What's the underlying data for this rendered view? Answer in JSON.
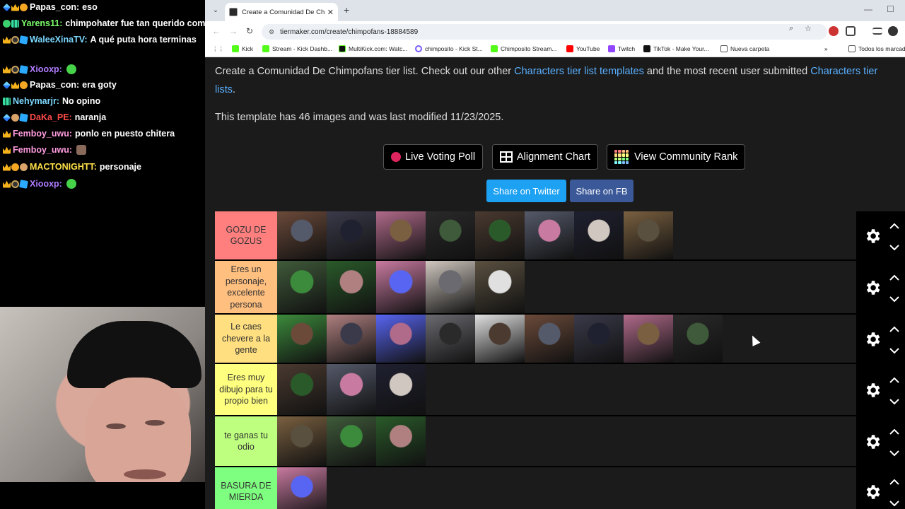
{
  "chat": {
    "messages": [
      {
        "user": "Papas_con:",
        "text": "eso",
        "color": "#ffffff",
        "badges": [
          "sword",
          "crown",
          "warn"
        ],
        "emote": ""
      },
      {
        "user": "Yarens11:",
        "text": "chimpohater fue tan querido como un here",
        "color": "#7cff6a",
        "badges": [
          "green",
          "grid"
        ],
        "emote": "green"
      },
      {
        "user": "WaleeXinaTV:",
        "text": "A qué puta hora terminas",
        "color": "#7cd8ff",
        "badges": [
          "crown",
          "glass",
          "cube"
        ],
        "emote": ""
      },
      {
        "user": "Xiooxp:",
        "text": "",
        "color": "#b07cff",
        "badges": [
          "crown",
          "glass",
          "cube"
        ],
        "emote": "green"
      },
      {
        "user": "Papas_con:",
        "text": "era goty",
        "color": "#ffffff",
        "badges": [
          "sword",
          "crown",
          "warn"
        ],
        "emote": ""
      },
      {
        "user": "Nehymarjr:",
        "text": "No opino",
        "color": "#7cd8ff",
        "badges": [
          "grid"
        ],
        "emote": ""
      },
      {
        "user": "DaKa_PE:",
        "text": "naranja",
        "color": "#ff4a4a",
        "badges": [
          "sword",
          "bear",
          "cube"
        ],
        "emote": ""
      },
      {
        "user": "Femboy_uwu:",
        "text": "ponlo en puesto chitera",
        "color": "#ff9be0",
        "badges": [
          "crown"
        ],
        "emote": ""
      },
      {
        "user": "Femboy_uwu:",
        "text": "",
        "color": "#ff9be0",
        "badges": [
          "crown"
        ],
        "emote": "cat"
      },
      {
        "user": "MACTONIGHTT:",
        "text": "personaje",
        "color": "#ffe14a",
        "badges": [
          "crown",
          "warn",
          "bear"
        ],
        "emote": ""
      },
      {
        "user": "Xiooxp:",
        "text": "",
        "color": "#b07cff",
        "badges": [
          "crown",
          "glass",
          "cube"
        ],
        "emote": "green"
      }
    ]
  },
  "browser": {
    "tab_title": "Create a Comunidad De Chimp",
    "url": "tiermaker.com/create/chimpofans-18884589",
    "bookmarks": [
      "Kick",
      "Stream - Kick Dashb...",
      "MultiKick.com: Watc...",
      "chimposito - Kick St...",
      "Chimposito Stream...",
      "YouTube",
      "Twitch",
      "TikTok - Make Your...",
      "Nueva carpeta",
      "Todos los marcad"
    ]
  },
  "page": {
    "intro_prefix": "Create a Comunidad De Chimpofans tier list. Check out our other ",
    "intro_link1": "Characters tier list templates",
    "intro_mid": " and the most recent user submitted ",
    "intro_link2": "Characters tier lists",
    "intro_suffix": ".",
    "template_info": "This template has 46 images and was last modified 11/23/2025.",
    "buttons": {
      "live_poll": "Live Voting Poll",
      "alignment": "Alignment Chart",
      "community_rank": "View Community Rank",
      "share_twitter": "Share on Twitter",
      "share_fb": "Share on FB"
    },
    "tiers": [
      {
        "label": "GOZU DE GOZUS",
        "color": "#ff7f7f",
        "tiles": 8
      },
      {
        "label": "Eres un personaje, excelente persona",
        "color": "#ffbf7f",
        "tiles": 5
      },
      {
        "label": "Le caes chevere a la gente",
        "color": "#ffdf7f",
        "tiles": 9
      },
      {
        "label": "Eres muy dibujo para tu propio bien",
        "color": "#ffff7f",
        "tiles": 3
      },
      {
        "label": "te ganas tu odio",
        "color": "#bfff7f",
        "tiles": 3
      },
      {
        "label": "BASURA DE MIERDA",
        "color": "#7fff7f",
        "tiles": 1
      }
    ]
  }
}
